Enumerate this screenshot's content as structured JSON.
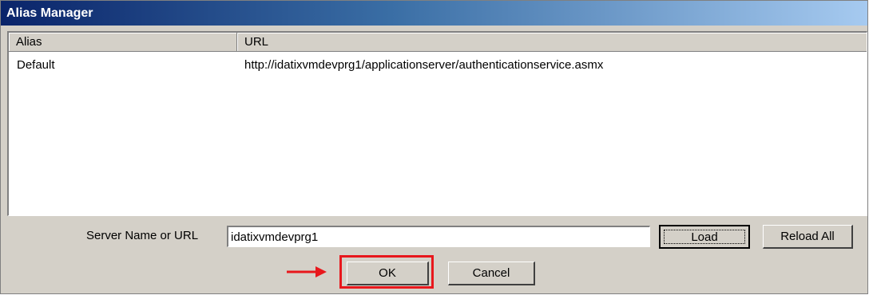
{
  "window": {
    "title": "Alias Manager"
  },
  "list": {
    "columns": [
      "Alias",
      "URL"
    ],
    "rows": [
      {
        "alias": "Default",
        "url": "http://idatixvmdevprg1/applicationserver/authenticationservice.asmx"
      }
    ]
  },
  "form": {
    "server_label": "Server Name or URL",
    "server_value": "idatixvmdevprg1"
  },
  "buttons": {
    "load": "Load",
    "reload_all": "Reload All",
    "ok": "OK",
    "cancel": "Cancel"
  },
  "annotation": {
    "highlight_color": "#e8171c",
    "arrow_icon": "right-arrow-icon"
  }
}
